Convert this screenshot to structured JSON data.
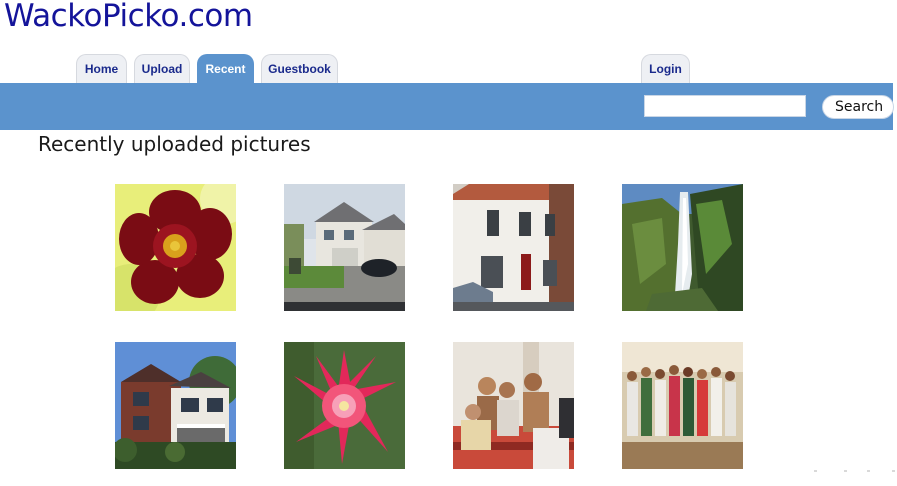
{
  "site": {
    "title": "WackoPicko.com"
  },
  "nav": {
    "tabs": [
      {
        "label": "Home",
        "active": false
      },
      {
        "label": "Upload",
        "active": false
      },
      {
        "label": "Recent",
        "active": true
      },
      {
        "label": "Guestbook",
        "active": false
      }
    ],
    "login_label": "Login"
  },
  "search": {
    "value": "",
    "button_label": "Search"
  },
  "main": {
    "heading": "Recently uploaded pictures",
    "pictures": [
      {
        "subject": "red flower close-up"
      },
      {
        "subject": "suburban house with garage and car"
      },
      {
        "subject": "white terraced house"
      },
      {
        "subject": "waterfall on mossy cliff"
      },
      {
        "subject": "red brick house with balconies"
      },
      {
        "subject": "pink cactus flower"
      },
      {
        "subject": "group of people indoors"
      },
      {
        "subject": "group of women in dresses"
      }
    ]
  },
  "colors": {
    "title": "#14149a",
    "nav_bar": "#5b93cd",
    "tab_text": "#1a2a8c",
    "tab_background": "#eef0f4"
  }
}
